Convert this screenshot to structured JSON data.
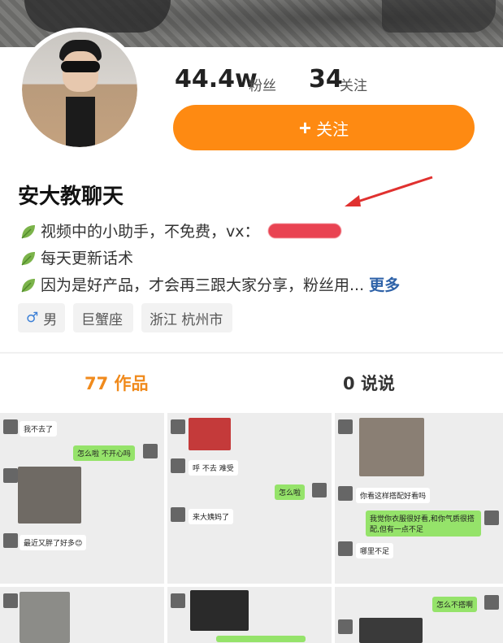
{
  "profile": {
    "fans_count": "44.4w",
    "fans_label": "粉丝",
    "following_count": "34",
    "following_label": "关注",
    "follow_button_label": "关注",
    "name": "安大教聊天",
    "bio": [
      "视频中的小助手，不免费，vx：",
      "每天更新话术",
      "因为是好产品，才会再三跟大家分享，粉丝用..."
    ],
    "more_label": "更多",
    "gender_label": "男",
    "zodiac": "巨蟹座",
    "location": "浙江 杭州市"
  },
  "tabs": {
    "works_count": "77",
    "works_label": "作品",
    "says_count": "0",
    "says_label": "说说"
  },
  "posts": {
    "p1": {
      "b1": "我不去了",
      "b2": "怎么啦 不开心吗",
      "b3": "最近又胖了好多😊"
    },
    "p2": {
      "b1": "呼 不去 难受",
      "b2": "怎么啦",
      "b3": "来大姨妈了"
    },
    "p3": {
      "b1": "你看这样搭配好看吗",
      "b2": "我觉你衣服很好看,和你气质很搭配,但有一点不足",
      "b3": "哪里不足"
    },
    "p6": {
      "b1": "怎么不搭啊"
    }
  },
  "colors": {
    "accent": "#fe8a12",
    "works_tab": "#f08a1c",
    "more_link": "#2e62a8"
  },
  "icons": {
    "leaf": "leaf-icon",
    "gender": "male-icon",
    "plus": "plus-icon"
  }
}
